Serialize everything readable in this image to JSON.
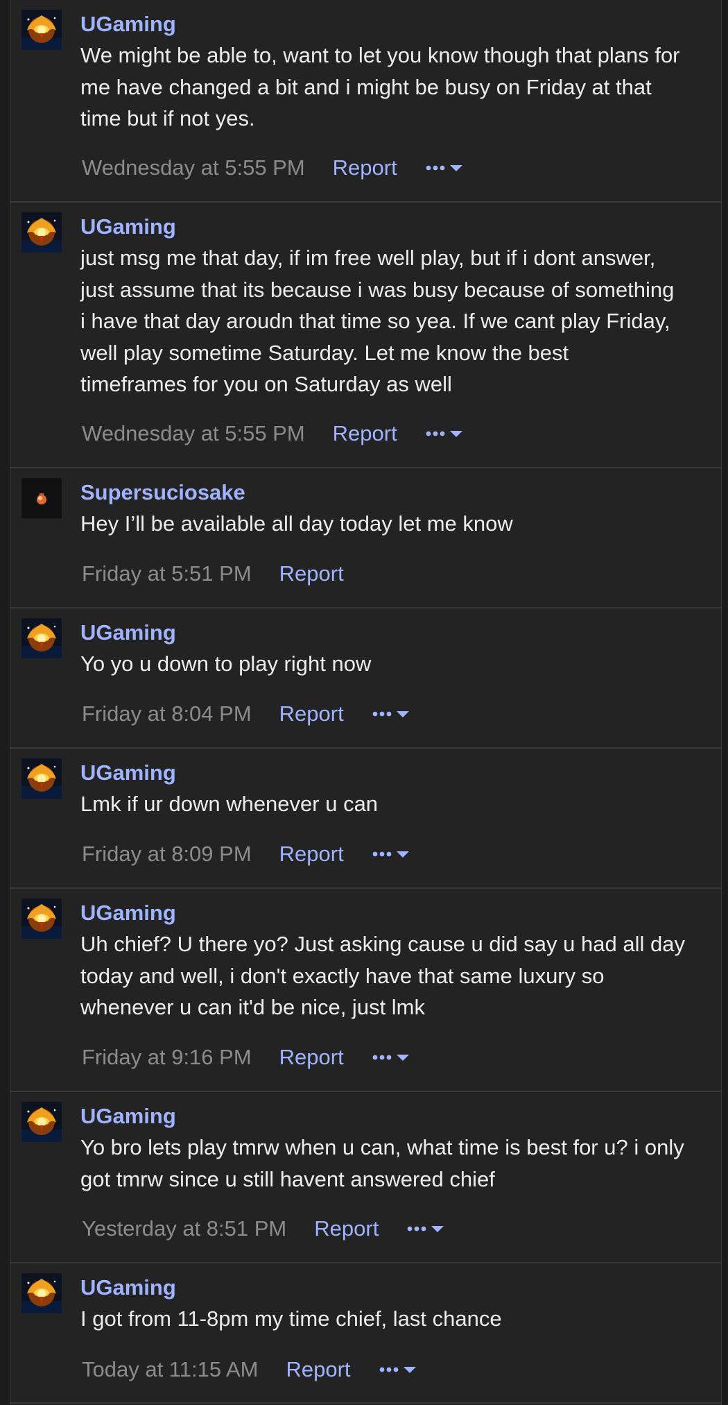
{
  "messages": [
    {
      "username": "UGaming",
      "avatar_icon": "ugaming-avatar",
      "text": "We might be able to, want to let you know though that plans for\nme have changed a bit and i might be busy on Friday at that\ntime but if not yes.",
      "timestamp": "Wednesday at 5:55 PM",
      "report_label": "Report",
      "has_more_menu": true
    },
    {
      "username": "UGaming",
      "avatar_icon": "ugaming-avatar",
      "text": "just msg me that day, if im free well play, but if i dont answer,\njust assume that its because i was busy because of something\ni have that day aroudn that time so yea. If we cant play Friday,\nwell play sometime Saturday. Let me know the best\ntimeframes for you on Saturday as well",
      "timestamp": "Wednesday at 5:55 PM",
      "report_label": "Report",
      "has_more_menu": true
    },
    {
      "username": "Supersuciosake",
      "avatar_icon": "supersuciosake-avatar",
      "text": "Hey I’ll be available all day today let me know",
      "timestamp": "Friday at 5:51 PM",
      "report_label": "Report",
      "has_more_menu": false
    },
    {
      "username": "UGaming",
      "avatar_icon": "ugaming-avatar",
      "text": "Yo yo u down to play right now",
      "timestamp": "Friday at 8:04 PM",
      "report_label": "Report",
      "has_more_menu": true
    },
    {
      "username": "UGaming",
      "avatar_icon": "ugaming-avatar",
      "text": "Lmk if ur down whenever u can",
      "timestamp": "Friday at 8:09 PM",
      "report_label": "Report",
      "has_more_menu": true
    },
    {
      "username": "UGaming",
      "avatar_icon": "ugaming-avatar",
      "text": "Uh chief? U there yo? Just asking cause u did say u had all day\ntoday and well, i don't exactly have that same luxury so\nwhenever u can it'd be nice, just lmk",
      "timestamp": "Friday at 9:16 PM",
      "report_label": "Report",
      "has_more_menu": true
    },
    {
      "username": "UGaming",
      "avatar_icon": "ugaming-avatar",
      "text": "Yo bro lets play tmrw when u can, what time is best for u? i only\ngot tmrw since u still havent answered chief",
      "timestamp": "Yesterday at 8:51 PM",
      "report_label": "Report",
      "has_more_menu": true
    },
    {
      "username": "UGaming",
      "avatar_icon": "ugaming-avatar",
      "text": "I got from 11-8pm my time chief, last chance",
      "timestamp": "Today at 11:15 AM",
      "report_label": "Report",
      "has_more_menu": true
    }
  ],
  "more_menu_icon": "ellipsis-caret-icon",
  "colors": {
    "background": "#232324",
    "username": "#a0b3ff",
    "link": "#a0b3ff",
    "text": "#ececec",
    "timestamp": "#8c8c8f",
    "divider": "#38383a"
  }
}
